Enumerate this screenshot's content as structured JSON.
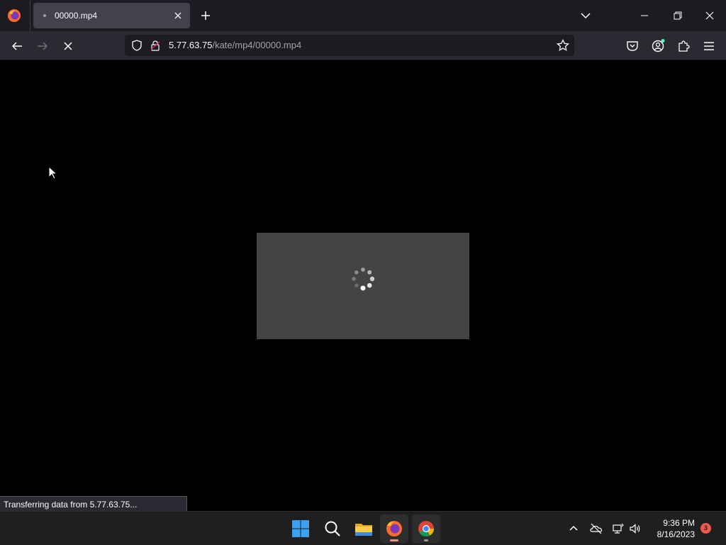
{
  "browser": {
    "tab": {
      "title": "00000.mp4"
    },
    "url": {
      "host": "5.77.63.75",
      "path": "/kate/mp4/00000.mp4"
    },
    "status_text": "Transferring data from 5.77.63.75..."
  },
  "icons": {
    "app": "firefox-icon",
    "tab_close": "close-icon",
    "new_tab": "plus-icon",
    "list_tabs": "chevron-down-icon",
    "back": "back-arrow-icon",
    "forward": "forward-arrow-icon",
    "stop": "stop-icon",
    "shield": "shield-icon",
    "lock": "lock-icon",
    "bookmark": "star-icon",
    "pocket": "pocket-icon",
    "account": "account-icon",
    "extensions": "puzzle-icon",
    "menu": "hamburger-icon",
    "spinner": "loading-spinner-icon"
  },
  "taskbar": {
    "apps": [
      "windows-start-icon",
      "search-icon",
      "file-explorer-icon",
      "firefox-icon",
      "chrome-icon"
    ],
    "tray": [
      "chevron-up-icon",
      "onedrive-icon",
      "network-icon",
      "volume-icon"
    ],
    "time": "9:36 PM",
    "date": "8/16/2023",
    "notification_count": "3"
  },
  "colors": {
    "tabbar_bg": "#1c1b22",
    "toolbar_bg": "#2b2a33",
    "active_tab": "#42414d",
    "video_bg": "#444444",
    "taskbar_bg": "#1f1f1f",
    "notification_badge": "#ef5a4e"
  }
}
